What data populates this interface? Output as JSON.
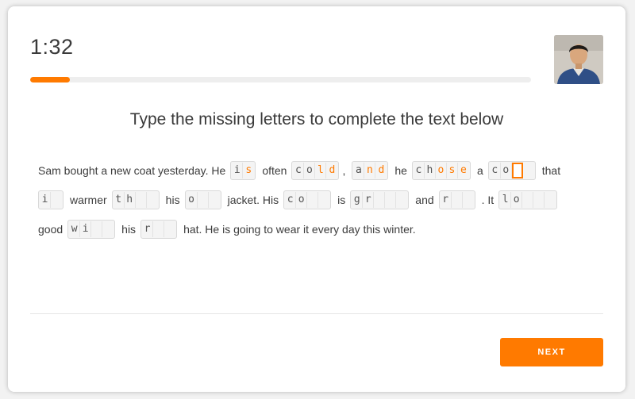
{
  "header": {
    "timer": "1:32",
    "progress_fraction": 0.08
  },
  "title": "Type the missing letters to complete the text below",
  "passage": {
    "lines": [
      [
        {
          "t": "word",
          "text": "Sam bought a new coat yesterday. He"
        },
        {
          "t": "blank",
          "cells": [
            {
              "c": "i",
              "s": "given"
            },
            {
              "c": "s",
              "s": "typed"
            }
          ]
        },
        {
          "t": "word",
          "text": "often"
        },
        {
          "t": "blank",
          "cells": [
            {
              "c": "c",
              "s": "given"
            },
            {
              "c": "o",
              "s": "given"
            },
            {
              "c": "l",
              "s": "typed"
            },
            {
              "c": "d",
              "s": "typed"
            }
          ]
        },
        {
          "t": "punct",
          "text": ","
        },
        {
          "t": "blank",
          "cells": [
            {
              "c": "a",
              "s": "given"
            },
            {
              "c": "n",
              "s": "typed"
            },
            {
              "c": "d",
              "s": "typed"
            }
          ]
        },
        {
          "t": "word",
          "text": "he"
        },
        {
          "t": "blank",
          "cells": [
            {
              "c": "c",
              "s": "given"
            },
            {
              "c": "h",
              "s": "given"
            },
            {
              "c": "o",
              "s": "typed"
            },
            {
              "c": "s",
              "s": "typed"
            },
            {
              "c": "e",
              "s": "typed"
            }
          ]
        },
        {
          "t": "word",
          "text": "a"
        },
        {
          "t": "blank",
          "cells": [
            {
              "c": "c",
              "s": "given"
            },
            {
              "c": "o",
              "s": "given"
            },
            {
              "c": "",
              "s": "cursor"
            },
            {
              "c": "",
              "s": "empty"
            }
          ]
        },
        {
          "t": "word",
          "text": "that"
        }
      ],
      [
        {
          "t": "blank",
          "cells": [
            {
              "c": "i",
              "s": "given"
            },
            {
              "c": "",
              "s": "empty"
            }
          ]
        },
        {
          "t": "word",
          "text": "warmer"
        },
        {
          "t": "blank",
          "cells": [
            {
              "c": "t",
              "s": "given"
            },
            {
              "c": "h",
              "s": "given"
            },
            {
              "c": "",
              "s": "empty"
            },
            {
              "c": "",
              "s": "empty"
            }
          ]
        },
        {
          "t": "word",
          "text": "his"
        },
        {
          "t": "blank",
          "cells": [
            {
              "c": "o",
              "s": "given"
            },
            {
              "c": "",
              "s": "empty"
            },
            {
              "c": "",
              "s": "empty"
            }
          ]
        },
        {
          "t": "word",
          "text": "jacket.  His"
        },
        {
          "t": "blank",
          "cells": [
            {
              "c": "c",
              "s": "given"
            },
            {
              "c": "o",
              "s": "given"
            },
            {
              "c": "",
              "s": "empty"
            },
            {
              "c": "",
              "s": "empty"
            }
          ]
        },
        {
          "t": "word",
          "text": "is"
        },
        {
          "t": "blank",
          "cells": [
            {
              "c": "g",
              "s": "given"
            },
            {
              "c": "r",
              "s": "given"
            },
            {
              "c": "",
              "s": "empty"
            },
            {
              "c": "",
              "s": "empty"
            },
            {
              "c": "",
              "s": "empty"
            }
          ]
        },
        {
          "t": "word",
          "text": "and"
        },
        {
          "t": "blank",
          "cells": [
            {
              "c": "r",
              "s": "given"
            },
            {
              "c": "",
              "s": "empty"
            },
            {
              "c": "",
              "s": "empty"
            }
          ]
        },
        {
          "t": "word",
          "text": ". It"
        },
        {
          "t": "blank",
          "cells": [
            {
              "c": "l",
              "s": "given"
            },
            {
              "c": "o",
              "s": "given"
            },
            {
              "c": "",
              "s": "empty"
            },
            {
              "c": "",
              "s": "empty"
            },
            {
              "c": "",
              "s": "empty"
            }
          ]
        }
      ],
      [
        {
          "t": "word",
          "text": "good"
        },
        {
          "t": "blank",
          "cells": [
            {
              "c": "w",
              "s": "given"
            },
            {
              "c": "i",
              "s": "given"
            },
            {
              "c": "",
              "s": "empty"
            },
            {
              "c": "",
              "s": "empty"
            }
          ]
        },
        {
          "t": "word",
          "text": "his"
        },
        {
          "t": "blank",
          "cells": [
            {
              "c": "r",
              "s": "given"
            },
            {
              "c": "",
              "s": "empty"
            },
            {
              "c": "",
              "s": "empty"
            }
          ]
        },
        {
          "t": "word",
          "text": "hat. He is going to wear it every day this winter."
        }
      ]
    ]
  },
  "footer": {
    "next_label": "NEXT"
  },
  "colors": {
    "accent": "#ff7a00",
    "track": "#eeeeee"
  },
  "icons": {
    "camera": "webcam-preview"
  }
}
